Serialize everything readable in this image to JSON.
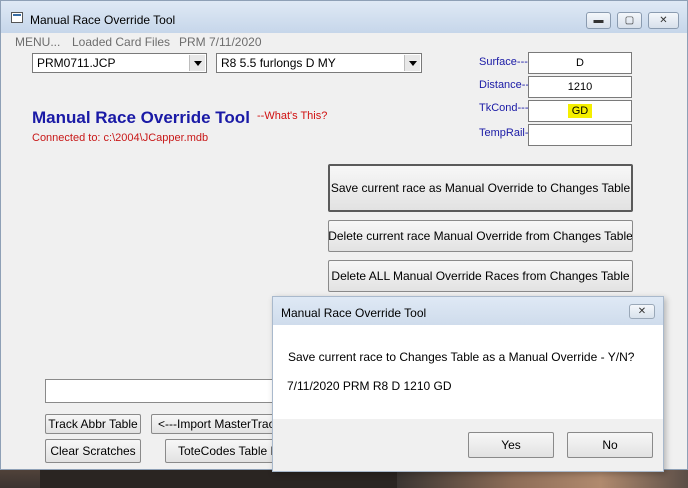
{
  "window": {
    "title": "Manual Race Override Tool",
    "controls": {
      "minimize": "▬",
      "maximize": "▢",
      "close": "✕"
    }
  },
  "menu": {
    "items": [
      "MENU...",
      "Loaded Card Files",
      "PRM 7/11/2020"
    ]
  },
  "selectors": {
    "card_file": "PRM0711.JCP",
    "race": "R8 5.5 furlongs D MY"
  },
  "header": {
    "title": "Manual Race Override Tool",
    "whats_this": "--What's This?",
    "connected": "Connected to: c:\\2004\\JCapper.mdb"
  },
  "fields": {
    "surface": {
      "label": "Surface---",
      "value": "D"
    },
    "distance": {
      "label": "Distance---",
      "value": "1210"
    },
    "tkcond": {
      "label": "TkCond---",
      "value": "GD"
    },
    "temprail": {
      "label": "TempRail-",
      "value": ""
    }
  },
  "actions": {
    "save": "Save current race as Manual Override to Changes Table",
    "delete_current": "Delete current race Manual Override from Changes Table",
    "delete_all": "Delete ALL Manual Override Races from Changes Table"
  },
  "lower": {
    "track_abbr": "Track Abbr Table",
    "import_mastertrack": "<---Import MasterTrack L",
    "clear_scratches": "Clear Scratches",
    "totecodes": "ToteCodes Table Mg"
  },
  "dialog": {
    "title": "Manual Race Override Tool",
    "close": "✕",
    "message": "Save current race to Changes Table as a Manual Override - Y/N?",
    "detail": "7/11/2020 PRM R8 D 1210 GD",
    "yes": "Yes",
    "no": "No"
  },
  "colors": {
    "title_blue": "#1a1aa6",
    "error_red": "#c81818",
    "highlight": "#f5ef00"
  }
}
